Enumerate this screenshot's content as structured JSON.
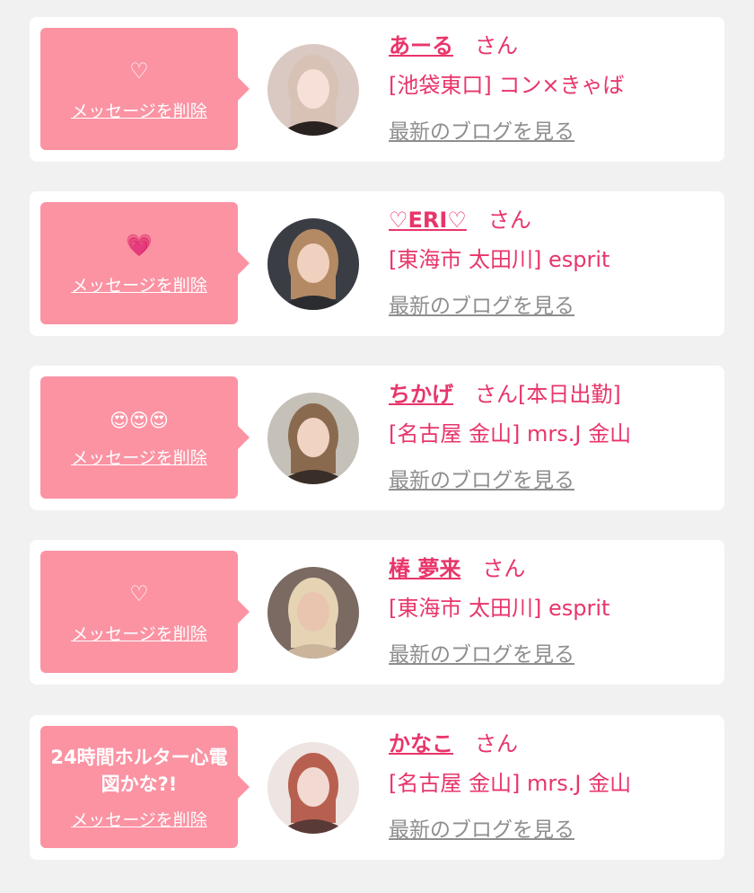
{
  "colors": {
    "accent": "#e8356a",
    "bubble": "#fb93a3",
    "link_gray": "#8e8e8e",
    "background": "#f1f1f1"
  },
  "entries": [
    {
      "message": "♡",
      "delete_label": "メッセージを削除",
      "name": "あーる",
      "suffix": "さん",
      "shop": "[池袋東口] コン×きゃば",
      "blog_label": "最新のブログを見る",
      "avatar": {
        "bg": "#d9c9c2",
        "hair": "#d8c2b5",
        "skin": "#f7e0d7",
        "top": "#2a2220",
        "icon": "avatar-photo"
      }
    },
    {
      "message": "💗",
      "delete_label": "メッセージを削除",
      "name": "♡ERI♡",
      "suffix": "さん",
      "shop": "[東海市 太田川] esprit",
      "blog_label": "最新のブログを見る",
      "avatar": {
        "bg": "#3a3d44",
        "hair": "#b48a64",
        "skin": "#f0d1bf",
        "top": "#2b2c30",
        "icon": "avatar-photo"
      }
    },
    {
      "message": "😍😍😍",
      "delete_label": "メッセージを削除",
      "name": "ちかげ",
      "suffix": "さん[本日出勤]",
      "shop": "[名古屋 金山] mrs.J 金山",
      "blog_label": "最新のブログを見る",
      "avatar": {
        "bg": "#c5c0b8",
        "hair": "#8a6a4f",
        "skin": "#f1d3c3",
        "top": "#3a2e28",
        "icon": "avatar-photo"
      }
    },
    {
      "message": "♡",
      "delete_label": "メッセージを削除",
      "name": "椿 夢来",
      "suffix": "さん",
      "shop": "[東海市 太田川] esprit",
      "blog_label": "最新のブログを見る",
      "avatar": {
        "bg": "#7a6a62",
        "hair": "#e5d3b4",
        "skin": "#e9c4ae",
        "top": "#cbb59a",
        "icon": "avatar-photo"
      }
    },
    {
      "message": "24時間ホルター心電図かな?!",
      "delete_label": "メッセージを削除",
      "name": "かなこ",
      "suffix": "さん",
      "shop": "[名古屋 金山] mrs.J 金山",
      "blog_label": "最新のブログを見る",
      "avatar": {
        "bg": "#eee4e1",
        "hair": "#b86050",
        "skin": "#f2dad2",
        "top": "#5a3a36",
        "icon": "avatar-photo"
      }
    }
  ]
}
